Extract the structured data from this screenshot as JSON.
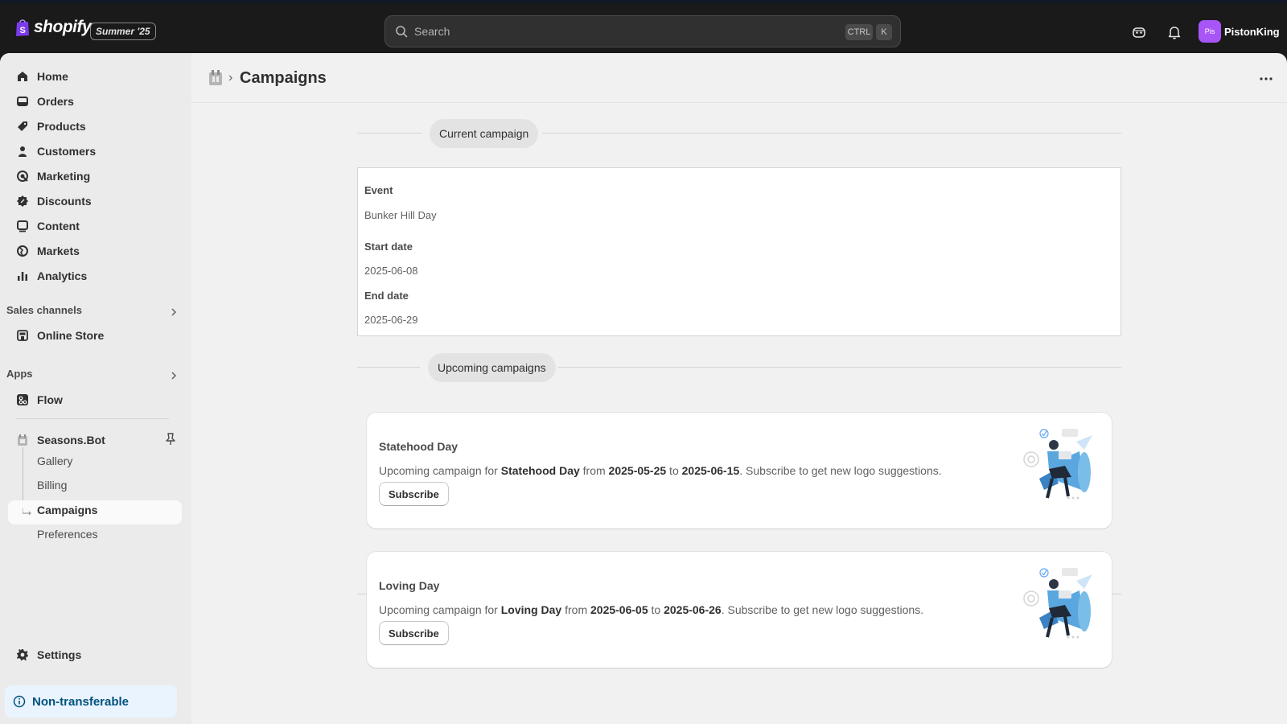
{
  "topbar": {
    "brand": "shopify",
    "edition": "Summer '25",
    "search_placeholder": "Search",
    "kbd_ctrl": "CTRL",
    "kbd_k": "K",
    "avatar_initials": "Pis",
    "username": "PistonKing"
  },
  "sidebar": {
    "nav": [
      {
        "label": "Home",
        "icon": "home-icon"
      },
      {
        "label": "Orders",
        "icon": "orders-icon"
      },
      {
        "label": "Products",
        "icon": "tag-icon"
      },
      {
        "label": "Customers",
        "icon": "person-icon"
      },
      {
        "label": "Marketing",
        "icon": "target-icon"
      },
      {
        "label": "Discounts",
        "icon": "discount-icon"
      },
      {
        "label": "Content",
        "icon": "content-icon"
      },
      {
        "label": "Markets",
        "icon": "globe-icon"
      },
      {
        "label": "Analytics",
        "icon": "bar-chart-icon"
      }
    ],
    "sales_channels_heading": "Sales channels",
    "online_store": "Online Store",
    "apps_heading": "Apps",
    "flow": "Flow",
    "app_name": "Seasons.Bot",
    "app_subitems": [
      "Gallery",
      "Billing",
      "Campaigns",
      "Preferences"
    ],
    "settings": "Settings",
    "non_transferable": "Non-transferable"
  },
  "page": {
    "title": "Campaigns",
    "current_heading": "Current campaign",
    "upcoming_heading": "Upcoming campaigns",
    "current": {
      "event_label": "Event",
      "event_value": "Bunker Hill Day",
      "start_label": "Start date",
      "start_value": "2025-06-08",
      "end_label": "End date",
      "end_value": "2025-06-29"
    },
    "upcoming": [
      {
        "name": "Statehood Day",
        "prefix": "Upcoming campaign for ",
        "event": "Statehood Day",
        "from_word": " from ",
        "start": "2025-05-25",
        "to_word": " to ",
        "end": "2025-06-15",
        "suffix": ". Subscribe to get new logo suggestions.",
        "button": "Subscribe"
      },
      {
        "name": "Loving Day",
        "prefix": "Upcoming campaign for ",
        "event": "Loving Day",
        "from_word": " from ",
        "start": "2025-06-05",
        "to_word": " to ",
        "end": "2025-06-26",
        "suffix": ". Subscribe to get new logo suggestions.",
        "button": "Subscribe"
      }
    ]
  },
  "colors": {
    "topbar_bg": "#1a1a1a",
    "sidebar_bg": "#ebebeb",
    "content_bg": "#f1f1f1",
    "avatar_bg": "#a855f7",
    "info_banner_bg": "#eaf4ff",
    "info_banner_text": "#00527c",
    "shopify_green": "#95bf47"
  }
}
